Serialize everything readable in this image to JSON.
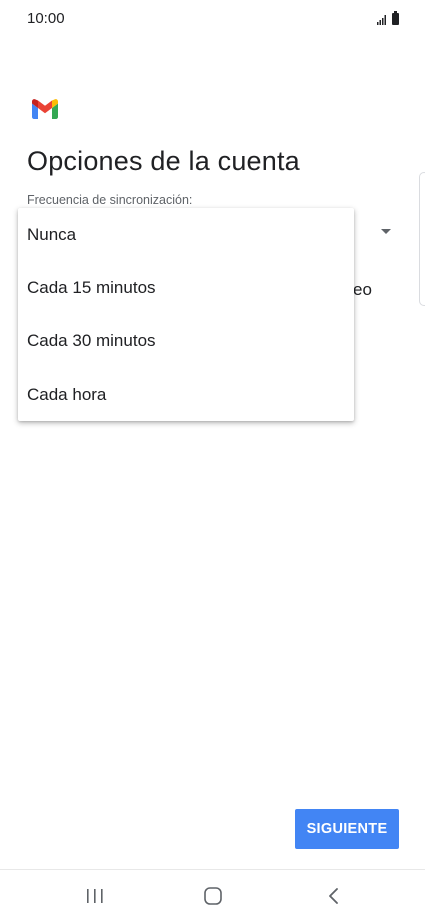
{
  "status_bar": {
    "time": "10:00",
    "signal_icon": "signal-icon",
    "battery_icon": "battery-icon"
  },
  "app": {
    "logo_icon": "gmail-logo-icon"
  },
  "page": {
    "title": "Opciones de la cuenta",
    "sync_label": "Frecuencia de sincronización:",
    "partially_hidden_text": "eo"
  },
  "dropdown": {
    "options": [
      {
        "label": "Nunca"
      },
      {
        "label": "Cada 15 minutos"
      },
      {
        "label": "Cada 30 minutos"
      },
      {
        "label": "Cada hora"
      }
    ]
  },
  "actions": {
    "next_label": "SIGUIENTE"
  },
  "nav": {
    "recent_icon": "recent-apps-icon",
    "home_icon": "home-icon",
    "back_icon": "back-icon"
  },
  "colors": {
    "accent": "#4285f4",
    "gmail_red": "#ea4335",
    "gmail_blue": "#4285f4",
    "gmail_green": "#34a853",
    "gmail_yellow": "#fbbc04"
  }
}
